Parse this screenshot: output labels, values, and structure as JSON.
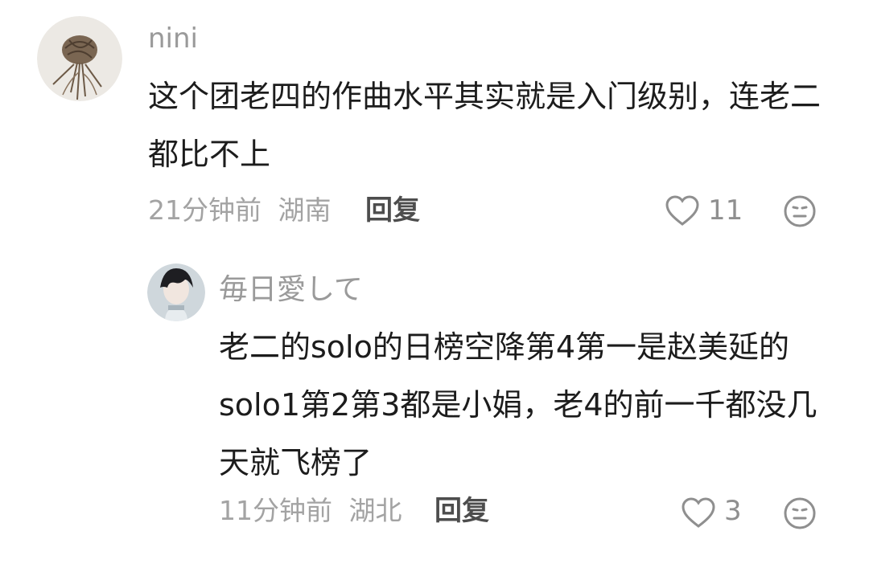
{
  "comments": [
    {
      "username": "nini",
      "content": "这个团老四的作曲水平其实就是入门级别，连老二都比不上",
      "time": "21分钟前",
      "location": "湖南",
      "reply_label": "回复",
      "like_count": "11",
      "icons": {
        "like": "heart-outline-icon",
        "dislike": "meh-face-icon"
      },
      "replies": [
        {
          "username": "毎日愛して",
          "content": "老二的solo的日榜空降第4第一是赵美延的solo1第2第3都是小娟，老4的前一千都没几天就飞榜了",
          "time": "11分钟前",
          "location": "湖北",
          "reply_label": "回复",
          "like_count": "3"
        }
      ]
    }
  ],
  "colors": {
    "text": "#1c1c1c",
    "muted": "#a3a3a3",
    "username": "#9a9a9a",
    "icon": "#8f8f8f"
  }
}
